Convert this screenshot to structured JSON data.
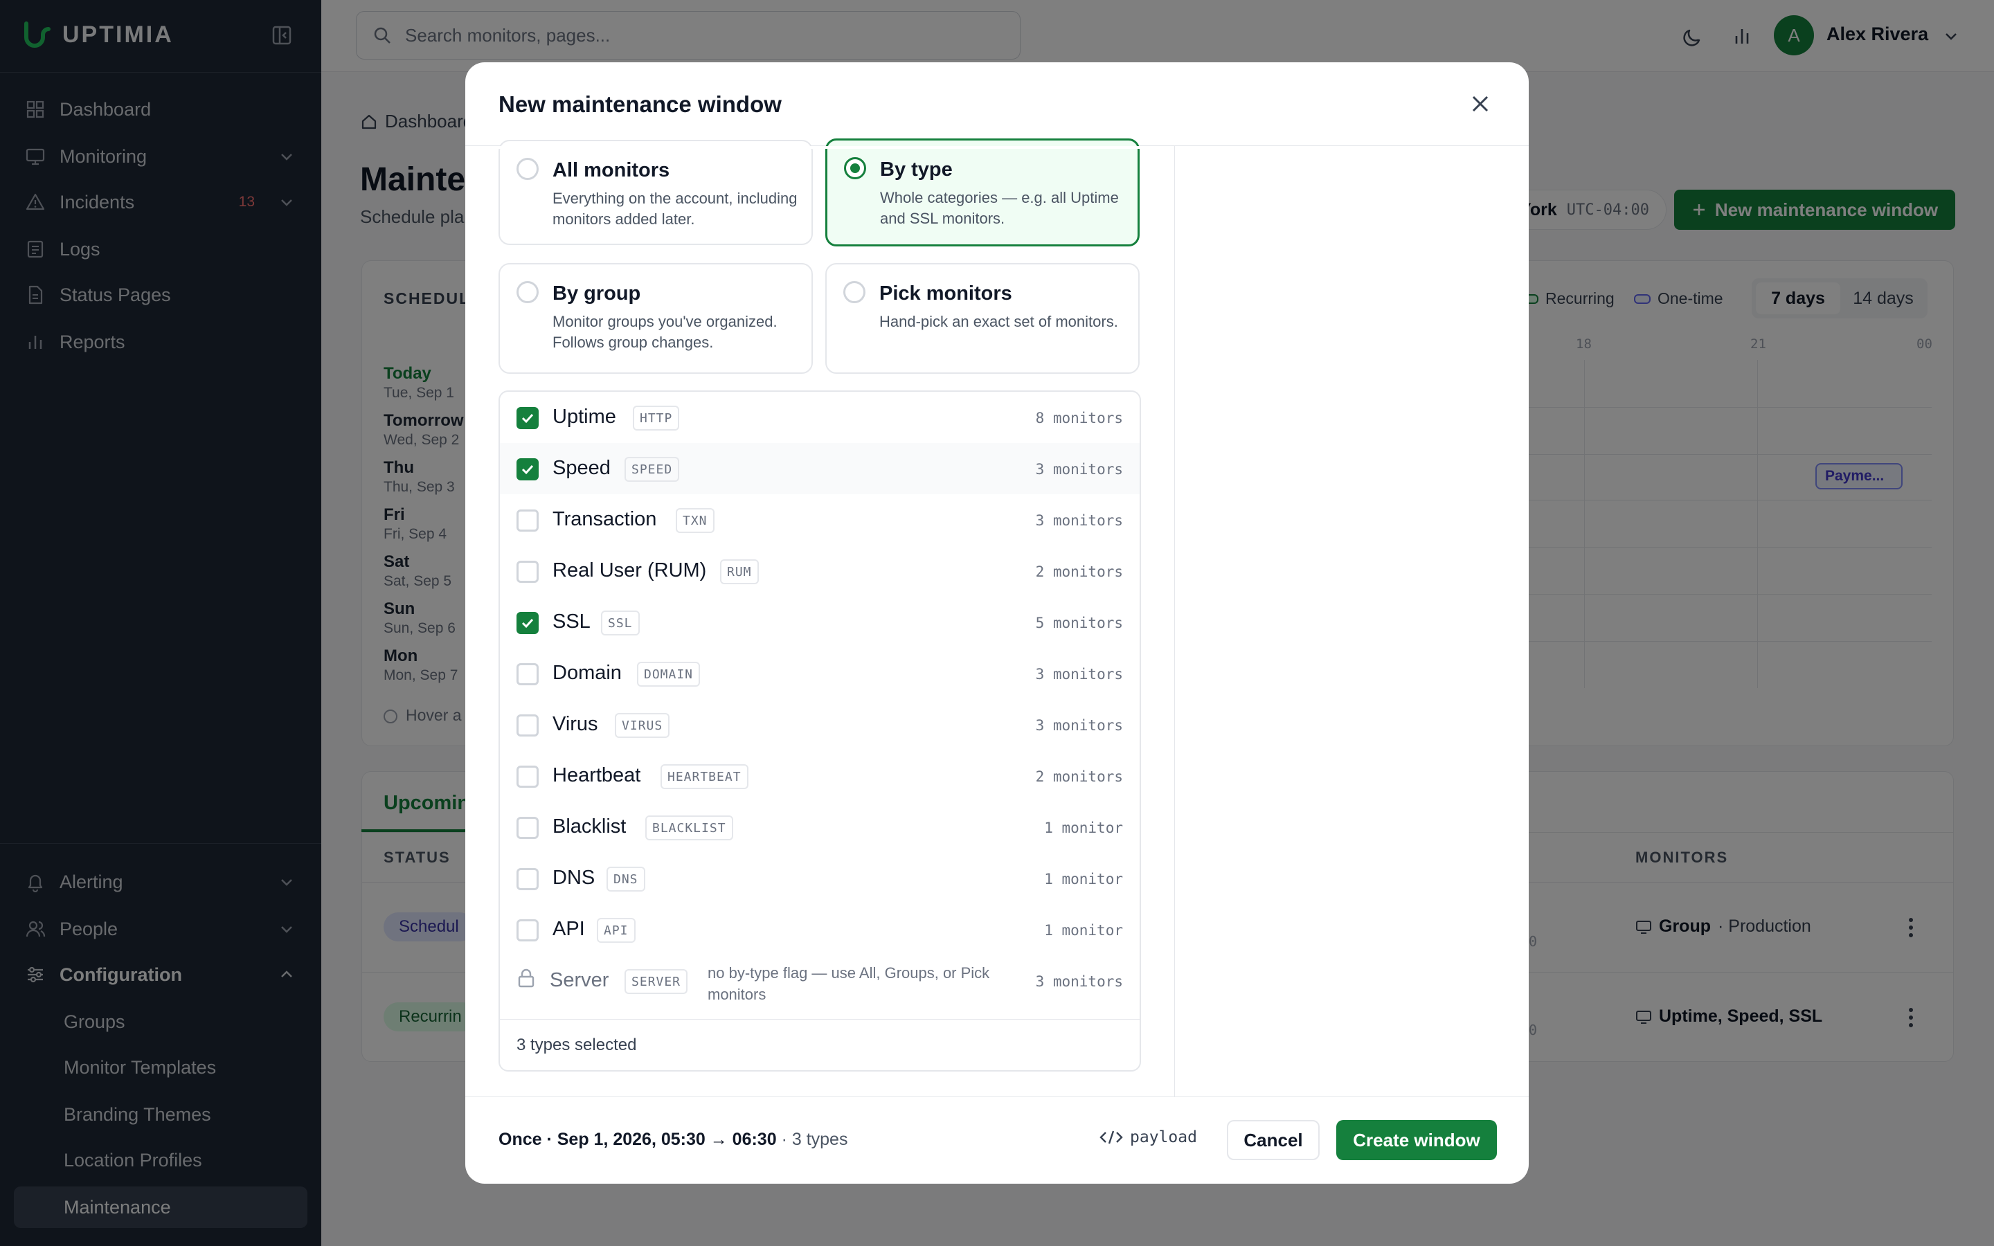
{
  "app": {
    "brand": "UPTIMIA"
  },
  "sidebar": {
    "items": [
      {
        "label": "Dashboard"
      },
      {
        "label": "Monitoring"
      },
      {
        "label": "Incidents",
        "badge": "13"
      },
      {
        "label": "Logs"
      },
      {
        "label": "Status Pages"
      },
      {
        "label": "Reports"
      }
    ],
    "bottom": [
      {
        "label": "Alerting"
      },
      {
        "label": "People"
      },
      {
        "label": "Configuration"
      }
    ],
    "config_sub": [
      {
        "label": "Groups"
      },
      {
        "label": "Monitor Templates"
      },
      {
        "label": "Branding Themes"
      },
      {
        "label": "Location Profiles"
      },
      {
        "label": "Maintenance"
      }
    ]
  },
  "topbar": {
    "search_placeholder": "Search monitors, pages...",
    "avatar_initial": "A",
    "user_name": "Alex Rivera"
  },
  "page": {
    "breadcrumb": "Dashboard",
    "title": "Mainte",
    "subtitle": "Schedule pla",
    "tz_city": "York",
    "tz_offset": "UTC-04:00",
    "new_button": "New maintenance window",
    "schedule_title": "SCHEDUL",
    "legend_recurring": "Recurring",
    "legend_onetime": "One-time",
    "range_7": "7 days",
    "range_14": "14 days",
    "ticks": [
      "18",
      "21",
      "00"
    ],
    "days": [
      {
        "d1": "Today",
        "d2": "Tue, Sep 1"
      },
      {
        "d1": "Tomorrow",
        "d2": "Wed, Sep 2"
      },
      {
        "d1": "Thu",
        "d2": "Thu, Sep 3"
      },
      {
        "d1": "Fri",
        "d2": "Fri, Sep 4"
      },
      {
        "d1": "Sat",
        "d2": "Sat, Sep 5"
      },
      {
        "d1": "Sun",
        "d2": "Sun, Sep 6"
      },
      {
        "d1": "Mon",
        "d2": "Mon, Sep 7"
      }
    ],
    "event_chip": "Payme...",
    "hover_hint": "Hover a",
    "tab_upcoming": "Upcomin",
    "col_status": "STATUS",
    "col_monitors": "MONITORS",
    "row1": {
      "status": "Schedul",
      "mon_bold": "Group",
      "mon_rest": "· Production",
      "frag": "0"
    },
    "row2": {
      "status": "Recurrin",
      "mon_bold": "Uptime, Speed, SSL",
      "frag": "0"
    }
  },
  "modal": {
    "title": "New maintenance window",
    "scopes": [
      {
        "title": "All monitors",
        "desc": "Everything on the account, including monitors added later."
      },
      {
        "title": "By type",
        "desc": "Whole categories — e.g. all Uptime and SSL monitors."
      },
      {
        "title": "By group",
        "desc": "Monitor groups you've organized. Follows group changes."
      },
      {
        "title": "Pick monitors",
        "desc": "Hand-pick an exact set of monitors."
      }
    ],
    "selected_scope": "By type",
    "types": [
      {
        "name": "Uptime",
        "tag": "HTTP",
        "count": "8 monitors",
        "checked": true
      },
      {
        "name": "Speed",
        "tag": "SPEED",
        "count": "3 monitors",
        "checked": true
      },
      {
        "name": "Transaction",
        "tag": "TXN",
        "count": "3 monitors",
        "checked": false
      },
      {
        "name": "Real User (RUM)",
        "tag": "RUM",
        "count": "2 monitors",
        "checked": false
      },
      {
        "name": "SSL",
        "tag": "SSL",
        "count": "5 monitors",
        "checked": true
      },
      {
        "name": "Domain",
        "tag": "DOMAIN",
        "count": "3 monitors",
        "checked": false
      },
      {
        "name": "Virus",
        "tag": "VIRUS",
        "count": "3 monitors",
        "checked": false
      },
      {
        "name": "Heartbeat",
        "tag": "HEARTBEAT",
        "count": "2 monitors",
        "checked": false
      },
      {
        "name": "Blacklist",
        "tag": "BLACKLIST",
        "count": "1 monitor",
        "checked": false
      },
      {
        "name": "DNS",
        "tag": "DNS",
        "count": "1 monitor",
        "checked": false
      },
      {
        "name": "API",
        "tag": "API",
        "count": "1 monitor",
        "checked": false
      }
    ],
    "locked_type": {
      "name": "Server",
      "tag": "SERVER",
      "note": "no by-type flag — use All, Groups, or Pick monitors",
      "count": "3 monitors"
    },
    "selected_summary": "3 types selected",
    "footer": {
      "summary_bold": "Once · Sep 1, 2026, 05:30 → 06:30",
      "summary_rest": "· 3 types",
      "payload": "payload",
      "cancel": "Cancel",
      "create": "Create window"
    }
  },
  "colors": {
    "accent": "#15803d",
    "sidebar_bg": "#1f2937",
    "recurring": "#15803d",
    "onetime": "#6366f1"
  }
}
